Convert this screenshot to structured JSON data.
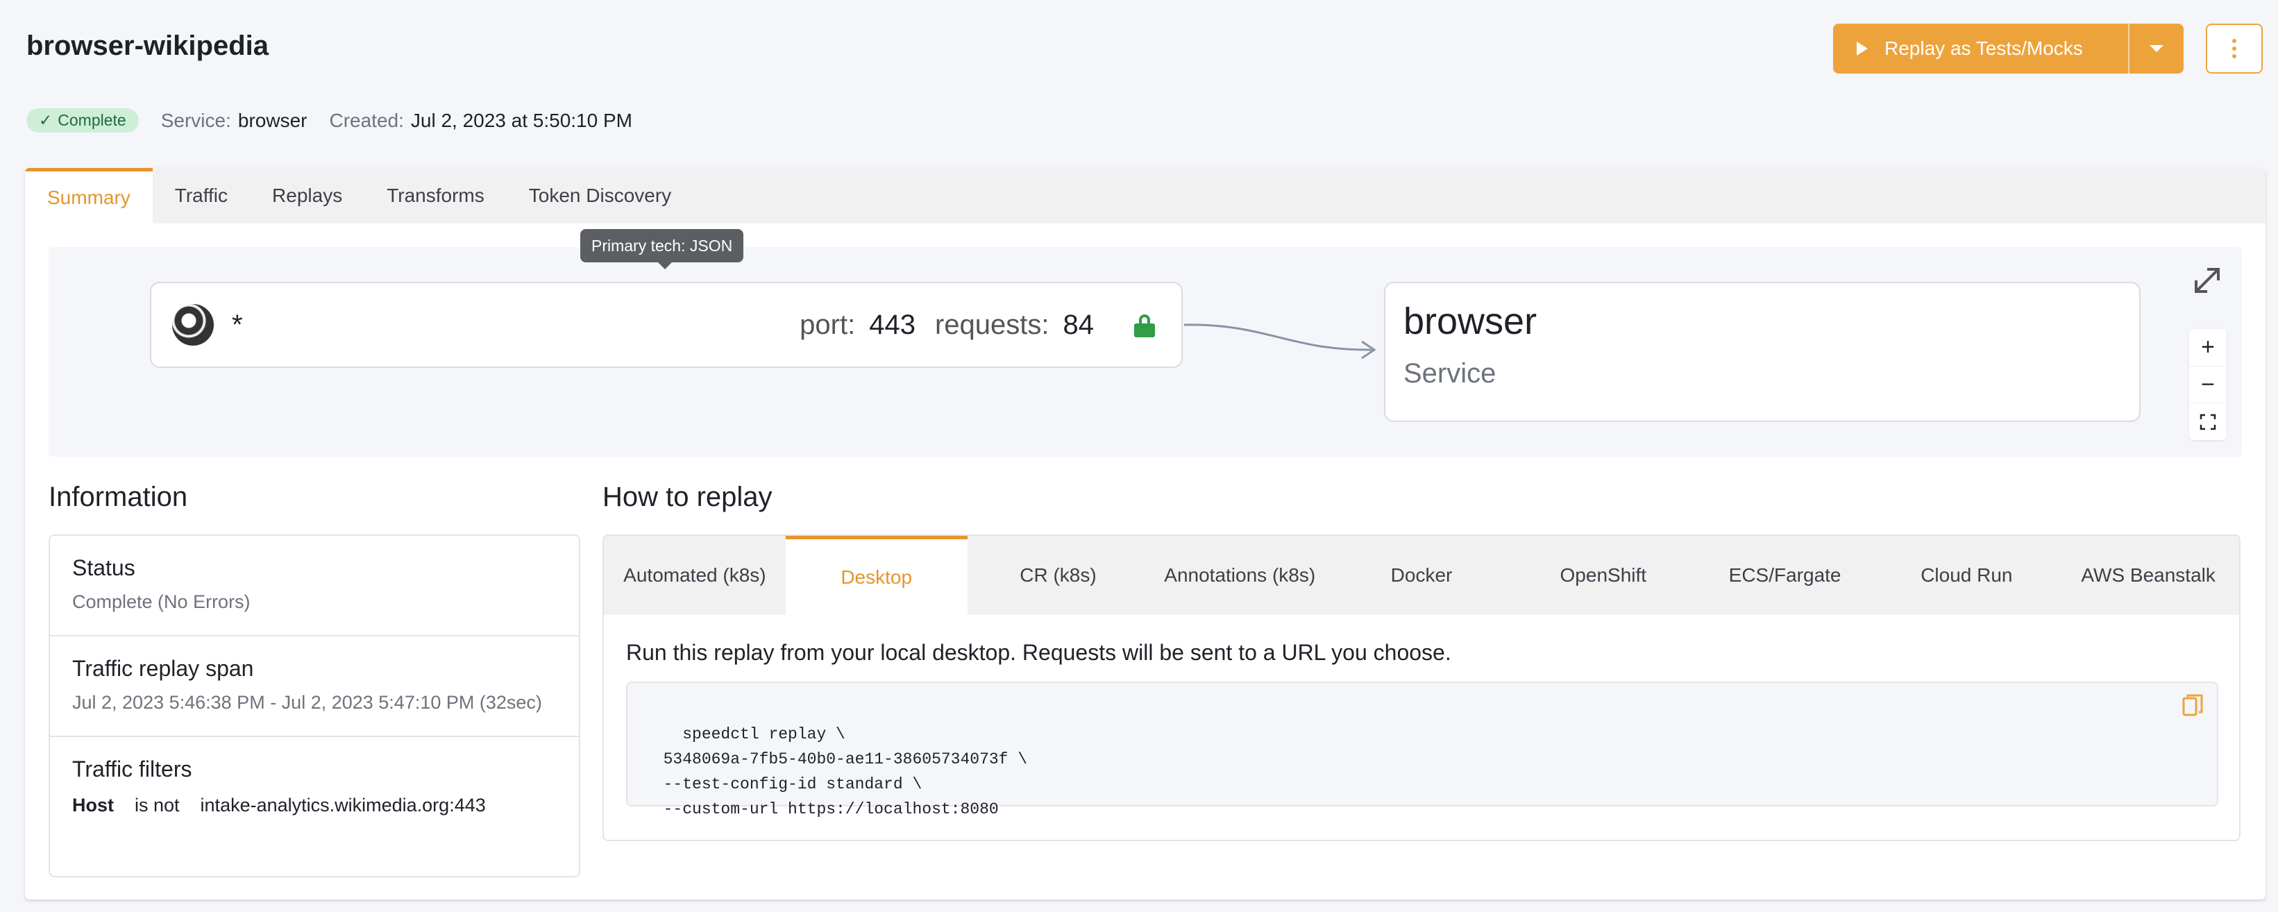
{
  "header": {
    "title": "browser-wikipedia",
    "replay_button": "Replay as Tests/Mocks",
    "status_badge": "Complete",
    "service_label": "Service:",
    "service_value": "browser",
    "created_label": "Created:",
    "created_value": "Jul 2, 2023 at 5:50:10 PM"
  },
  "tabs": [
    "Summary",
    "Traffic",
    "Replays",
    "Transforms",
    "Token Discovery"
  ],
  "graph": {
    "tooltip": "Primary tech: JSON",
    "source_node": {
      "host": "*",
      "port_label": "port:",
      "port_value": "443",
      "requests_label": "requests:",
      "requests_value": "84"
    },
    "service_node": {
      "name": "browser",
      "type": "Service"
    },
    "zoom_in": "+",
    "zoom_out": "−"
  },
  "information": {
    "title": "Information",
    "status_label": "Status",
    "status_value": "Complete (No Errors)",
    "span_label": "Traffic replay span",
    "span_value": "Jul 2, 2023 5:46:38 PM - Jul 2, 2023 5:47:10 PM (32sec)",
    "filters_label": "Traffic filters",
    "filter": {
      "key": "Host",
      "op": "is not",
      "value": "intake-analytics.wikimedia.org:443"
    }
  },
  "howto": {
    "title": "How to replay",
    "tabs": [
      "Automated (k8s)",
      "Desktop",
      "CR (k8s)",
      "Annotations (k8s)",
      "Docker",
      "OpenShift",
      "ECS/Fargate",
      "Cloud Run",
      "AWS Beanstalk"
    ],
    "description": "Run this replay from your local desktop. Requests will be sent to a URL you choose.",
    "code": "speedctl replay \\\n  5348069a-7fb5-40b0-ae11-38605734073f \\\n  --test-config-id standard \\\n  --custom-url https://localhost:8080"
  },
  "colors": {
    "accent": "#eda33c",
    "success": "#2f9e44",
    "badge_bg": "#cfeed7"
  }
}
